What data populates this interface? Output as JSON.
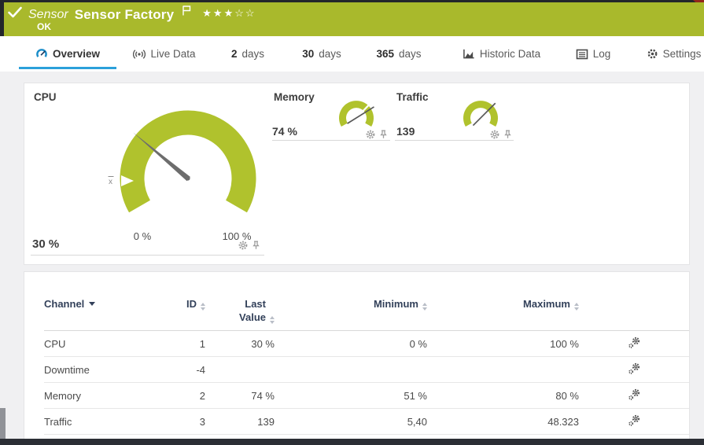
{
  "titlebar": {
    "kind": "Sensor",
    "title": "Sensor Factory",
    "status": "OK",
    "stars_filled": "★★★",
    "stars_empty": "☆☆",
    "priority_filled": 3,
    "priority_total": 5
  },
  "tabs": [
    {
      "num": "",
      "label": "Overview"
    },
    {
      "num": "",
      "label": "Live Data"
    },
    {
      "num": "2",
      "label": "days"
    },
    {
      "num": "30",
      "label": "days"
    },
    {
      "num": "365",
      "label": "days"
    },
    {
      "num": "",
      "label": "Historic Data"
    },
    {
      "num": "",
      "label": "Log"
    },
    {
      "num": "",
      "label": "Settings"
    }
  ],
  "gauges": {
    "cpu": {
      "title": "CPU",
      "value": "30 %",
      "scale_min": "0 %",
      "scale_max": "100 %",
      "needle_deg": -50,
      "avg_label": "x"
    },
    "memory": {
      "title": "Memory",
      "value": "74 %",
      "needle_deg": 58
    },
    "traffic": {
      "title": "Traffic",
      "value": "139",
      "needle_deg": 45
    }
  },
  "colors": {
    "status_green": "#a9b92c",
    "gauge_green": "#b0c22d",
    "accent_blue": "#2ba0da",
    "header_navy": "#33415a"
  },
  "table": {
    "headers": {
      "channel": "Channel",
      "id": "ID",
      "last_value": "Last Value",
      "minimum": "Minimum",
      "maximum": "Maximum"
    },
    "rows": [
      {
        "channel": "CPU",
        "id": "1",
        "last": "30 %",
        "min": "0 %",
        "max": "100 %"
      },
      {
        "channel": "Downtime",
        "id": "-4",
        "last": "",
        "min": "",
        "max": ""
      },
      {
        "channel": "Memory",
        "id": "2",
        "last": "74 %",
        "min": "51 %",
        "max": "80 %"
      },
      {
        "channel": "Traffic",
        "id": "3",
        "last": "139",
        "min": "5,40",
        "max": "48.323"
      }
    ]
  }
}
